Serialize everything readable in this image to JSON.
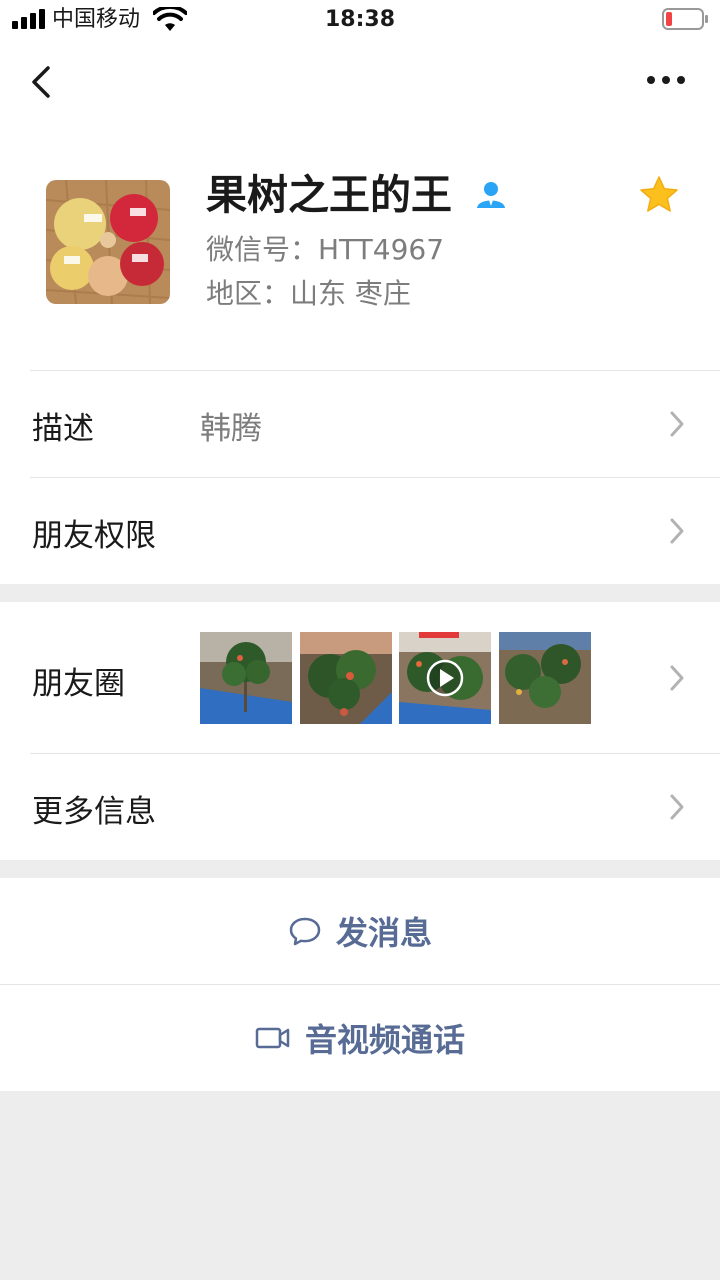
{
  "status_bar": {
    "carrier": "中国移动",
    "time": "18:38"
  },
  "profile": {
    "name": "果树之王的王",
    "wechat_id": "微信号：HTT4967",
    "region": "地区：山东 枣庄"
  },
  "rows": {
    "description": {
      "label": "描述",
      "value": "韩腾"
    },
    "permissions": {
      "label": "朋友权限"
    },
    "moments": {
      "label": "朋友圈"
    },
    "more_info": {
      "label": "更多信息"
    }
  },
  "actions": {
    "send_message": "发消息",
    "video_call": "音视频通话"
  },
  "colors": {
    "link_blue": "#576b95",
    "star_yellow": "#fbbf1e",
    "friend_icon_blue": "#2aa4f4",
    "battery_red": "#f24444"
  }
}
